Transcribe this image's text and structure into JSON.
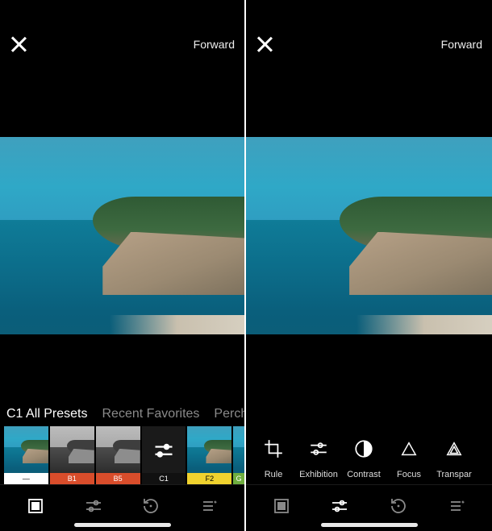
{
  "header": {
    "forward_label": "Forward"
  },
  "left": {
    "categories": [
      {
        "label": "C1 All Presets",
        "active": true
      },
      {
        "label": "Recent Favorites",
        "active": false
      },
      {
        "label": "Perch",
        "active": false
      }
    ],
    "presets": [
      {
        "id": "orig",
        "label": "—"
      },
      {
        "id": "b1",
        "label": "B1"
      },
      {
        "id": "b5",
        "label": "B5"
      },
      {
        "id": "c1",
        "label": "C1"
      },
      {
        "id": "f2",
        "label": "F2"
      },
      {
        "id": "g",
        "label": "G"
      }
    ],
    "active_tab": "presets"
  },
  "right": {
    "tools": [
      {
        "id": "rule",
        "label": "Rule"
      },
      {
        "id": "exhibition",
        "label": "Exhibition"
      },
      {
        "id": "contrast",
        "label": "Contrast"
      },
      {
        "id": "focus",
        "label": "Focus"
      },
      {
        "id": "transpar",
        "label": "Transpar"
      }
    ],
    "active_tab": "adjust"
  }
}
